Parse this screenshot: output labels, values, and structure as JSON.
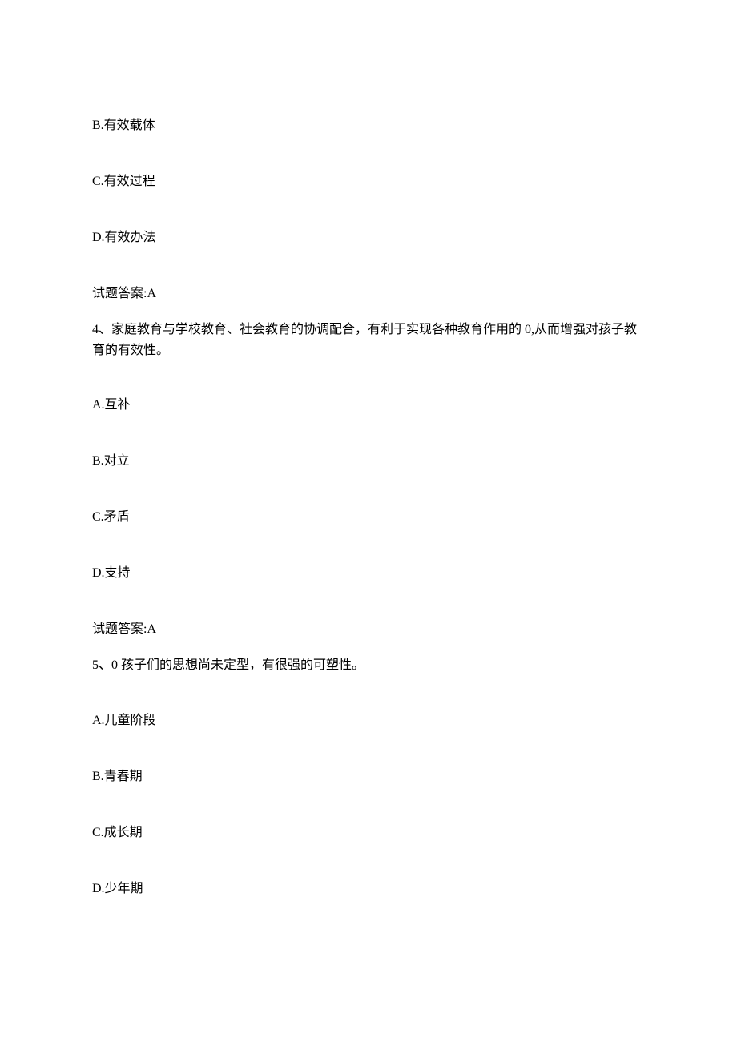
{
  "q3_remainder": {
    "option_b": "B.有效载体",
    "option_c": "C.有效过程",
    "option_d": "D.有效办法",
    "answer": "试题答案:A"
  },
  "q4": {
    "text": "4、家庭教育与学校教育、社会教育的协调配合，有利于实现各种教育作用的 0,从而增强对孩子教育的有效性。",
    "option_a": "A.互补",
    "option_b": "B.对立",
    "option_c": "C.矛盾",
    "option_d": "D.支持",
    "answer": "试题答案:A"
  },
  "q5": {
    "text": "5、0 孩子们的思想尚未定型，有很强的可塑性。",
    "option_a": "A.儿童阶段",
    "option_b": "B.青春期",
    "option_c": "C.成长期",
    "option_d": "D.少年期"
  }
}
